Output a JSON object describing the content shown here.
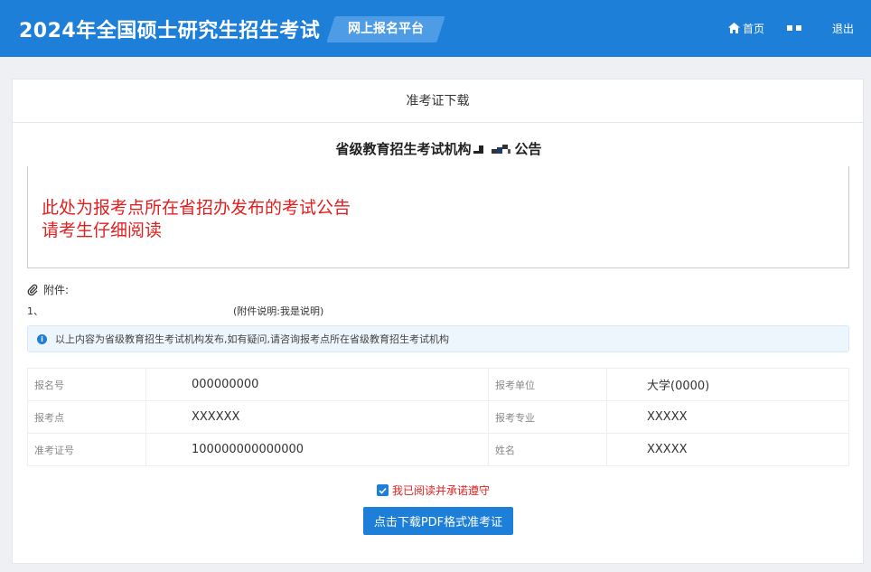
{
  "header": {
    "site_title": "2024年全国硕士研究生招生考试",
    "platform_label": "网上报名平台",
    "home_label": "首页",
    "logout_label": "退出"
  },
  "card": {
    "title": "准考证下载",
    "notice_title_prefix": "省级教育招生考试机构",
    "notice_title_suffix": "公告",
    "notice_lines": [
      "此处为报考点所在省招办发布的考试公告",
      "请考生仔细阅读"
    ],
    "attachments_label": "附件:",
    "attachment_index": "1、",
    "attachment_desc": "(附件说明:我是说明)",
    "info_text": "以上内容为省级教育招生考试机构发布,如有疑问,请咨询报考点所在省级教育招生考试机构"
  },
  "candidate": {
    "rows": [
      {
        "label1": "报名号",
        "value1": "000000000",
        "label2": "报考单位",
        "value2": "大学(0000)"
      },
      {
        "label1": "报考点",
        "value1": "XXXXXX",
        "label2": "报考专业",
        "value2": "XXXXX"
      },
      {
        "label1": "准考证号",
        "value1": "100000000000000",
        "label2": "姓名",
        "value2": "XXXXX"
      }
    ]
  },
  "agreement": {
    "label": "我已阅读并承诺遵守",
    "checked": true
  },
  "download_button": "点击下载PDF格式准考证",
  "colors": {
    "primary": "#1e7fd9",
    "warning_text": "#e02020",
    "background": "#eef0f3"
  }
}
